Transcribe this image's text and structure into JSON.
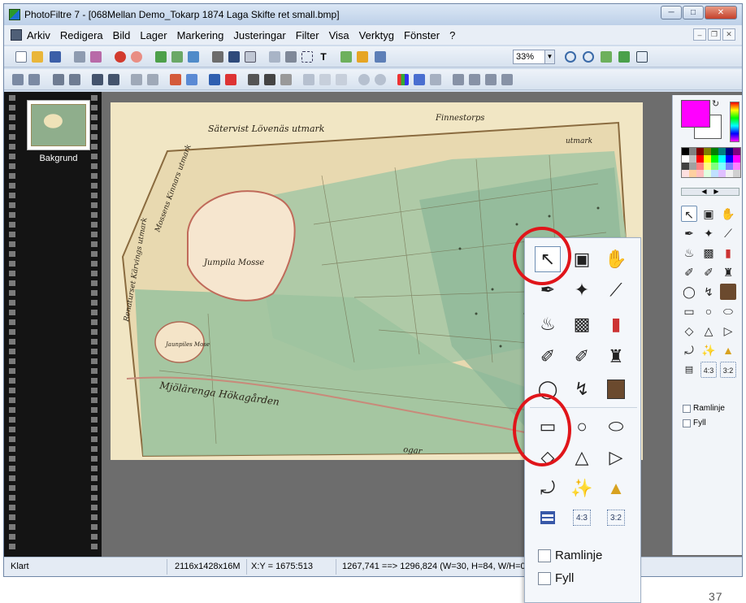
{
  "window": {
    "title": "PhotoFiltre 7 - [068Mellan Demo_Tokarp 1874 Laga Skifte ret small.bmp]"
  },
  "menu": [
    "Arkiv",
    "Redigera",
    "Bild",
    "Lager",
    "Markering",
    "Justeringar",
    "Filter",
    "Visa",
    "Verktyg",
    "Fönster",
    "?"
  ],
  "toolbar": {
    "zoom_value": "33%"
  },
  "layers": [
    {
      "label": "Bakgrund"
    }
  ],
  "map_text": {
    "top_label": "Sätervist Lövenäs utmark",
    "top_right": "Finnestorps",
    "top_far_right": "utmark",
    "left_vertical": "Mossens Kinnars utmark",
    "left_vertical2": "Renaturset Kärvings utmark",
    "mosse_label": "Jumpila Mosse",
    "small_label": "Jaunpiles Mose",
    "bottom_label": "Mjölärenga Hökagården",
    "bottom_right": "ogar"
  },
  "palette_colors": [
    "#000000",
    "#808080",
    "#800000",
    "#808000",
    "#008000",
    "#008080",
    "#000080",
    "#800080",
    "#ffffff",
    "#c0c0c0",
    "#ff0000",
    "#ffff00",
    "#00ff00",
    "#00ffff",
    "#0000ff",
    "#ff00ff",
    "#404040",
    "#a0a0a0",
    "#ff8080",
    "#ffff80",
    "#80ff80",
    "#80ffff",
    "#8080ff",
    "#ff80ff",
    "#ffe0e0",
    "#ffd0a0",
    "#ffc0c0",
    "#e0ffe0",
    "#c0e0ff",
    "#e0c0ff",
    "#f0f0f0",
    "#d0d0d0"
  ],
  "options": {
    "outline_label": "Ramlinje",
    "fill_label": "Fyll"
  },
  "statusbar": {
    "state": "Klart",
    "image_info": "2116x1428x16M",
    "cursor_pos": "X:Y = 1675:513",
    "selection": "1267,741 ==> 1296,824 (W=30, H=84, W/H=0,"
  },
  "zoom_panel_ratios": {
    "ratio_43": "4:3",
    "ratio_32": "3:2"
  },
  "page_number": "37",
  "accent": {
    "highlight_circle": "#e0151a",
    "foreground_color": "#ff00ff"
  }
}
